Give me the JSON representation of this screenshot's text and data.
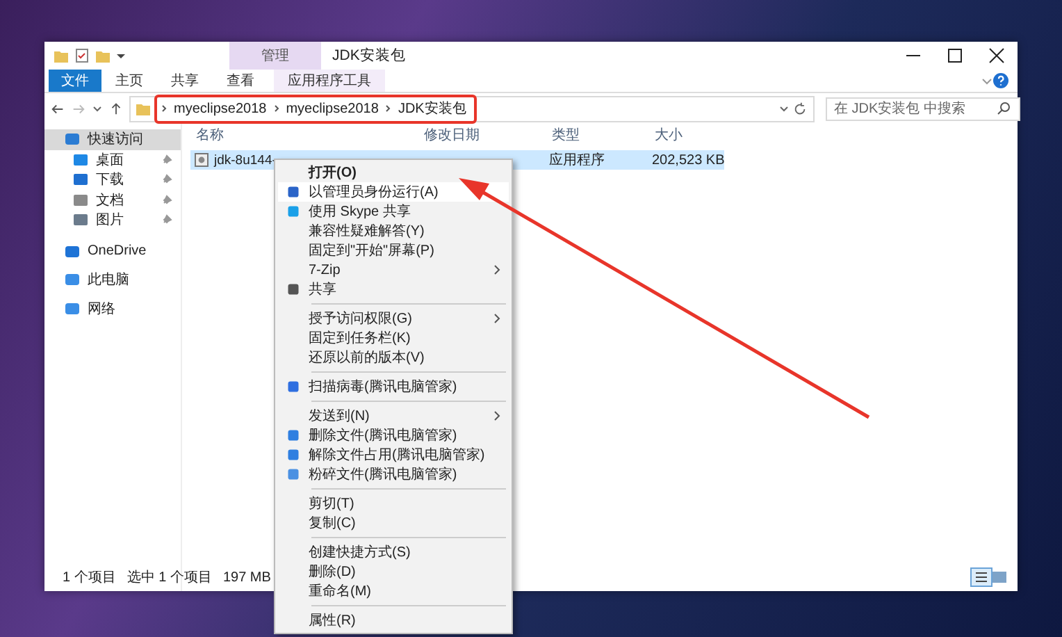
{
  "window": {
    "title": "JDK安装包",
    "context_tab": "管理"
  },
  "ribbon_tabs": [
    {
      "label": "文件",
      "kind": "file"
    },
    {
      "label": "主页",
      "kind": "tab"
    },
    {
      "label": "共享",
      "kind": "tab"
    },
    {
      "label": "查看",
      "kind": "tab"
    },
    {
      "label": "应用程序工具",
      "kind": "contextual"
    }
  ],
  "address": {
    "path": [
      "myeclipse2018",
      "myeclipse2018",
      "JDK安装包"
    ]
  },
  "search": {
    "placeholder": "在 JDK安装包 中搜索"
  },
  "sidebar": {
    "items": [
      {
        "label": "快速访问",
        "selected": true,
        "children": [
          {
            "label": "桌面",
            "pinned": true,
            "selected": false
          },
          {
            "label": "下载",
            "pinned": true,
            "selected": false
          },
          {
            "label": "文档",
            "pinned": true,
            "selected": false
          },
          {
            "label": "图片",
            "pinned": true,
            "selected": false
          }
        ]
      },
      {
        "label": "OneDrive",
        "selected": false
      },
      {
        "label": "此电脑",
        "selected": false
      },
      {
        "label": "网络",
        "selected": false
      }
    ]
  },
  "columns": [
    "名称",
    "修改日期",
    "类型",
    "大小"
  ],
  "files": [
    {
      "name": "jdk-8u144-",
      "type": "应用程序",
      "size": "202,523 KB",
      "selected": true
    }
  ],
  "context_menu": [
    {
      "kind": "item",
      "label": "打开(O)",
      "default": true,
      "highlighted": false
    },
    {
      "kind": "item",
      "label": "以管理员身份运行(A)",
      "default": false,
      "highlighted": true
    },
    {
      "kind": "item",
      "label": "使用 Skype 共享",
      "default": false,
      "highlighted": false
    },
    {
      "kind": "item",
      "label": "兼容性疑难解答(Y)",
      "default": false,
      "highlighted": false
    },
    {
      "kind": "item",
      "label": "固定到\"开始\"屏幕(P)",
      "default": false,
      "highlighted": false
    },
    {
      "kind": "submenu",
      "label": "7-Zip",
      "default": false,
      "highlighted": false
    },
    {
      "kind": "item",
      "label": "共享",
      "default": false,
      "highlighted": false
    },
    {
      "kind": "separator"
    },
    {
      "kind": "submenu",
      "label": "授予访问权限(G)",
      "default": false,
      "highlighted": false
    },
    {
      "kind": "item",
      "label": "固定到任务栏(K)",
      "default": false,
      "highlighted": false
    },
    {
      "kind": "item",
      "label": "还原以前的版本(V)",
      "default": false,
      "highlighted": false
    },
    {
      "kind": "separator"
    },
    {
      "kind": "item",
      "label": "扫描病毒(腾讯电脑管家)",
      "default": false,
      "highlighted": false
    },
    {
      "kind": "separator"
    },
    {
      "kind": "submenu",
      "label": "发送到(N)",
      "default": false,
      "highlighted": false
    },
    {
      "kind": "item",
      "label": "删除文件(腾讯电脑管家)",
      "default": false,
      "highlighted": false
    },
    {
      "kind": "item",
      "label": "解除文件占用(腾讯电脑管家)",
      "default": false,
      "highlighted": false
    },
    {
      "kind": "item",
      "label": "粉碎文件(腾讯电脑管家)",
      "default": false,
      "highlighted": false
    },
    {
      "kind": "separator"
    },
    {
      "kind": "item",
      "label": "剪切(T)",
      "default": false,
      "highlighted": false
    },
    {
      "kind": "item",
      "label": "复制(C)",
      "default": false,
      "highlighted": false
    },
    {
      "kind": "separator"
    },
    {
      "kind": "item",
      "label": "创建快捷方式(S)",
      "default": false,
      "highlighted": false
    },
    {
      "kind": "item",
      "label": "删除(D)",
      "default": false,
      "highlighted": false
    },
    {
      "kind": "item",
      "label": "重命名(M)",
      "default": false,
      "highlighted": false
    },
    {
      "kind": "separator"
    },
    {
      "kind": "item",
      "label": "属性(R)",
      "default": false,
      "highlighted": false
    }
  ],
  "status_bar": {
    "count": "1 个项目",
    "selection": "选中 1 个项目",
    "size": "197 MB"
  }
}
